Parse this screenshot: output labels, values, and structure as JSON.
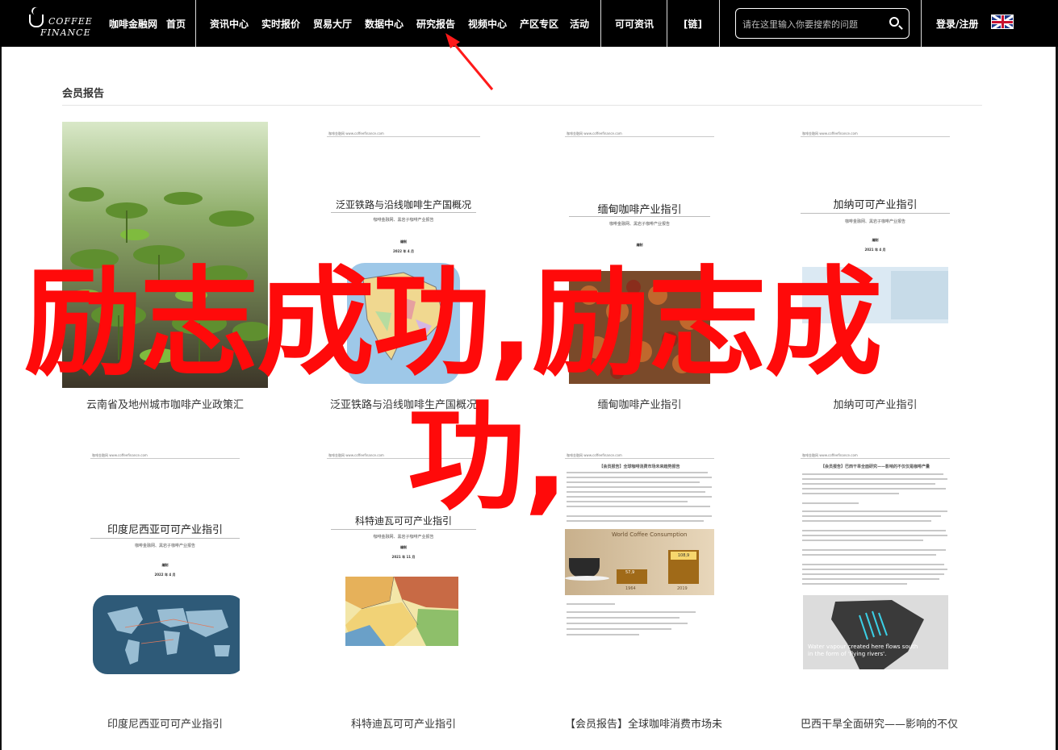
{
  "site": {
    "logo_text_1": "COFFEE",
    "logo_text_2": "FINANCE",
    "nav_items": [
      "咖啡金融网",
      "首页",
      "资讯中心",
      "实时报价",
      "贸易大厅",
      "数据中心",
      "研究报告",
      "视频中心",
      "产区专区",
      "活动",
      "可可资讯",
      "[链]"
    ],
    "search_placeholder": "请在这里输入你要搜索的问题",
    "login_label": "登录/注册"
  },
  "section": {
    "title": "会员报告"
  },
  "cards": [
    {
      "caption": "云南省及地州城市咖啡产业政策汇"
    },
    {
      "caption": "泛亚铁路与沿线咖啡生产国概况",
      "doc_title": "泛亚铁路与沿线咖啡生产国概况",
      "doc_sub": "咖啡金融网、黑岩子咖啡产业报告",
      "doc_tiny_1": "编制",
      "doc_tiny_2": "2022 年 4 月"
    },
    {
      "caption": "缅甸咖啡产业指引",
      "doc_title": "缅甸咖啡产业指引",
      "doc_sub": "咖啡金融网、黑岩子咖啡产业报告",
      "doc_tiny_1": "编制",
      "doc_tiny_2": "2022 年 4 月"
    },
    {
      "caption": "加纳可可产业指引",
      "doc_title": "加纳可可产业指引",
      "doc_sub": "咖啡金融网、黑岩子咖啡产业报告",
      "doc_tiny_1": "编制",
      "doc_tiny_2": "2021 年 4 月"
    },
    {
      "caption": "印度尼西亚可可产业指引",
      "doc_title": "印度尼西亚可可产业指引",
      "doc_sub": "咖啡金融网、黑岩子咖啡产业报告",
      "doc_tiny_1": "编制",
      "doc_tiny_2": "2022 年 4 月"
    },
    {
      "caption": "科特迪瓦可可产业指引",
      "doc_title": "科特迪瓦可可产业指引",
      "doc_sub": "咖啡金融网、黑岩子咖啡产业报告",
      "doc_tiny_1": "编制",
      "doc_tiny_2": "2021 年 11 月"
    },
    {
      "caption": "【会员报告】全球咖啡消费市场未",
      "doc_title": "【会员报告】全球咖啡消费市场未来趋势报告",
      "chart_title": "World Coffee Consumption",
      "chart_values": [
        "57,9",
        "108,9"
      ],
      "chart_years": [
        "1964",
        "2019"
      ]
    },
    {
      "caption": "巴西干旱全面研究——影响的不仅",
      "doc_title": "【会员报告】巴西干旱全面研究——影响的不仅仅是咖啡产量",
      "map_caption": "Water vapour created here flows south in the form of 'flying rivers'."
    }
  ],
  "doc_header_meta": "咖啡金融网  www.coffeefinance.com",
  "overlay": {
    "line1": "励志成功,励志成",
    "line2": "功,"
  },
  "colors": {
    "overlay_red": "#ff0a0a",
    "arrow_red": "#ff1a1a",
    "topbar": "#000000"
  }
}
